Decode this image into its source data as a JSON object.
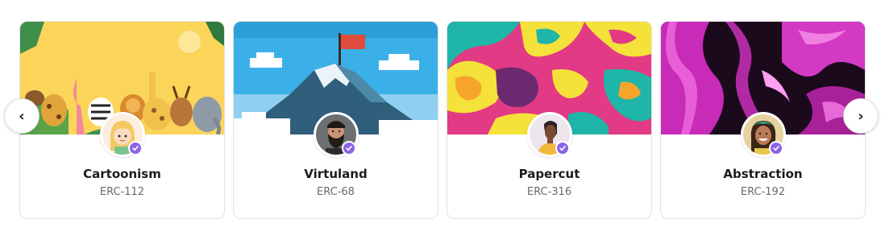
{
  "carousel": {
    "prev_icon": "chevron-left-icon",
    "prev_glyph": "‹",
    "next_icon": "chevron-right-icon",
    "next_glyph": "›",
    "accent_color": "#8a63e6",
    "cards": [
      {
        "title": "Cartoonism",
        "subtitle": "ERC-112",
        "banner": "cartoon-animals-banner",
        "avatar": "cartoon-girl-avatar",
        "verified": true
      },
      {
        "title": "Virtuland",
        "subtitle": "ERC-68",
        "banner": "pixel-mountain-flag-banner",
        "avatar": "bearded-man-avatar",
        "verified": true
      },
      {
        "title": "Papercut",
        "subtitle": "ERC-316",
        "banner": "colorful-papercut-banner",
        "avatar": "illustrated-person-avatar",
        "verified": true
      },
      {
        "title": "Abstraction",
        "subtitle": "ERC-192",
        "banner": "pink-marble-banner",
        "avatar": "smiling-woman-avatar",
        "verified": true
      }
    ]
  }
}
